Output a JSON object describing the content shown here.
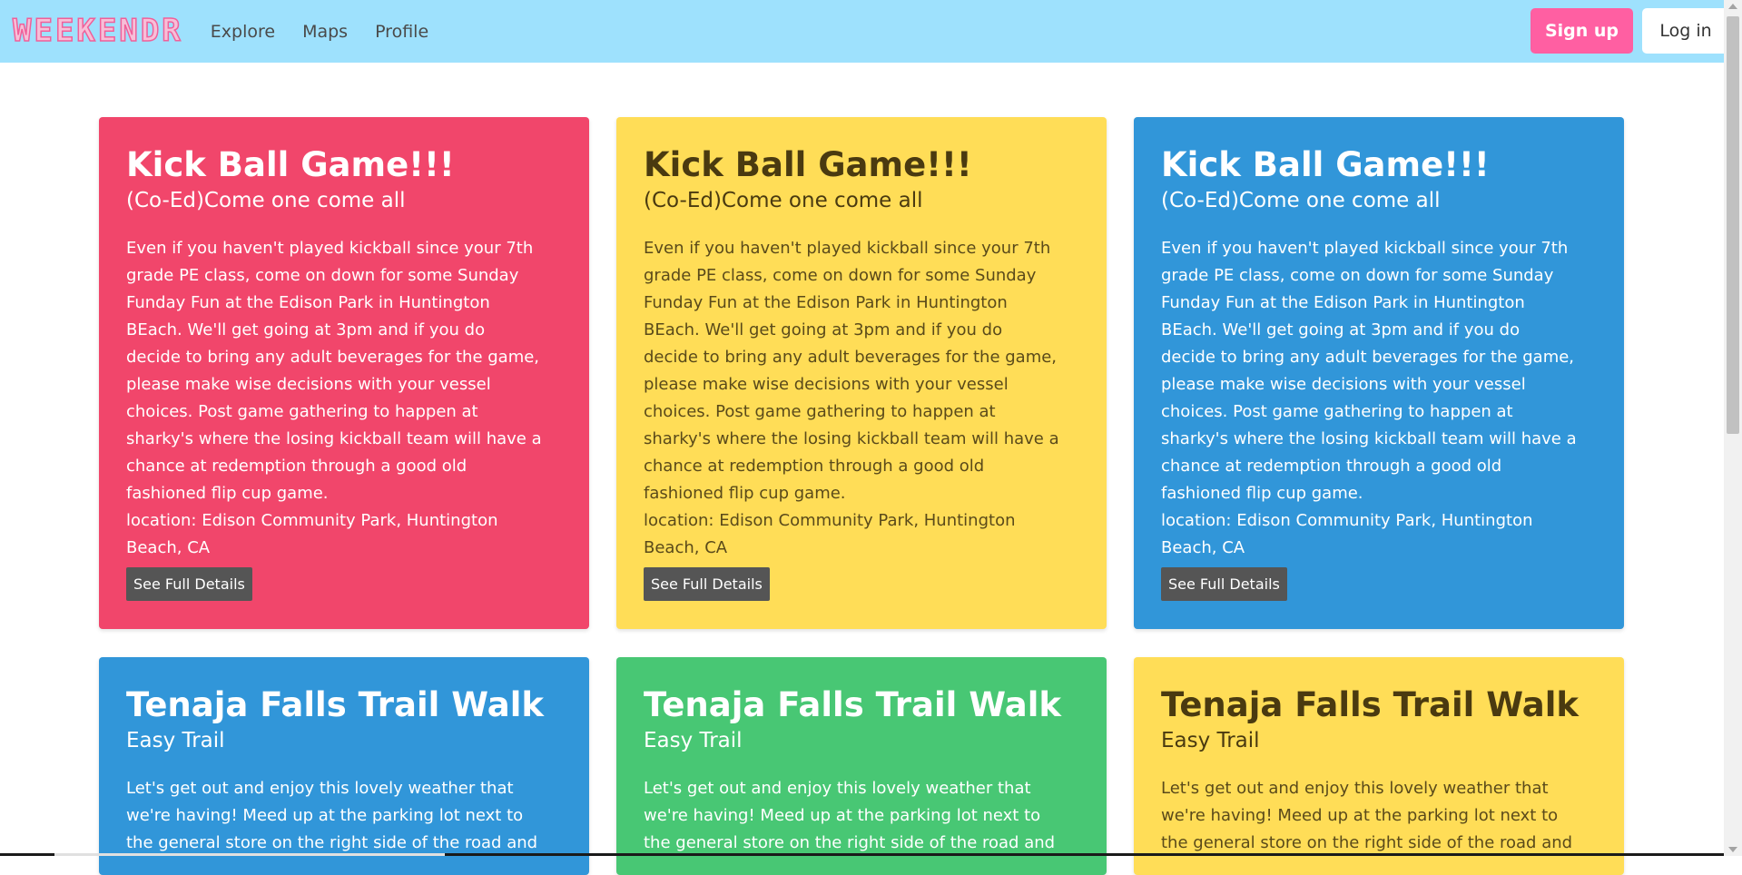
{
  "nav": {
    "brand": "WEEKENDR",
    "links": [
      "Explore",
      "Maps",
      "Profile"
    ],
    "signup_label": "Sign up",
    "login_label": "Log in"
  },
  "colors": {
    "navbar": "#9ee1fd",
    "red": "#f1466b",
    "yellow": "#ffdd57",
    "blue": "#3196d9",
    "green": "#48c774",
    "signup": "#ff5fa2"
  },
  "events": [
    {
      "title": "Kick Ball Game!!!",
      "subtitle": "(Co-Ed)Come one come all",
      "description": "Even if you haven't played kickball since your 7th grade PE class, come on down for some Sunday Funday Fun at the Edison Park in Huntington BEach. We'll get going at 3pm and if you do decide to bring any adult beverages for the game, please make wise decisions with your vessel choices. Post game gathering to happen at sharky's where the losing kickball team will have a chance at redemption through a good old fashioned flip cup game.",
      "location": "location: Edison Community Park, Huntington Beach, CA",
      "button": "See Full Details",
      "color": "red"
    },
    {
      "title": "Kick Ball Game!!!",
      "subtitle": "(Co-Ed)Come one come all",
      "description": "Even if you haven't played kickball since your 7th grade PE class, come on down for some Sunday Funday Fun at the Edison Park in Huntington BEach. We'll get going at 3pm and if you do decide to bring any adult beverages for the game, please make wise decisions with your vessel choices. Post game gathering to happen at sharky's where the losing kickball team will have a chance at redemption through a good old fashioned flip cup game.",
      "location": "location: Edison Community Park, Huntington Beach, CA",
      "button": "See Full Details",
      "color": "yellow"
    },
    {
      "title": "Kick Ball Game!!!",
      "subtitle": "(Co-Ed)Come one come all",
      "description": "Even if you haven't played kickball since your 7th grade PE class, come on down for some Sunday Funday Fun at the Edison Park in Huntington BEach. We'll get going at 3pm and if you do decide to bring any adult beverages for the game, please make wise decisions with your vessel choices. Post game gathering to happen at sharky's where the losing kickball team will have a chance at redemption through a good old fashioned flip cup game.",
      "location": "location: Edison Community Park, Huntington Beach, CA",
      "button": "See Full Details",
      "color": "blue"
    },
    {
      "title": "Tenaja Falls Trail Walk",
      "subtitle": "Easy Trail",
      "description": "Let's get out and enjoy this lovely weather that we're having! Meed up at the parking lot next to the general store on the right side of the road and",
      "color": "blue"
    },
    {
      "title": "Tenaja Falls Trail Walk",
      "subtitle": "Easy Trail",
      "description": "Let's get out and enjoy this lovely weather that we're having! Meed up at the parking lot next to the general store on the right side of the road and",
      "color": "green"
    },
    {
      "title": "Tenaja Falls Trail Walk",
      "subtitle": "Easy Trail",
      "description": "Let's get out and enjoy this lovely weather that we're having! Meed up at the parking lot next to the general store on the right side of the road and",
      "color": "yellow"
    }
  ]
}
